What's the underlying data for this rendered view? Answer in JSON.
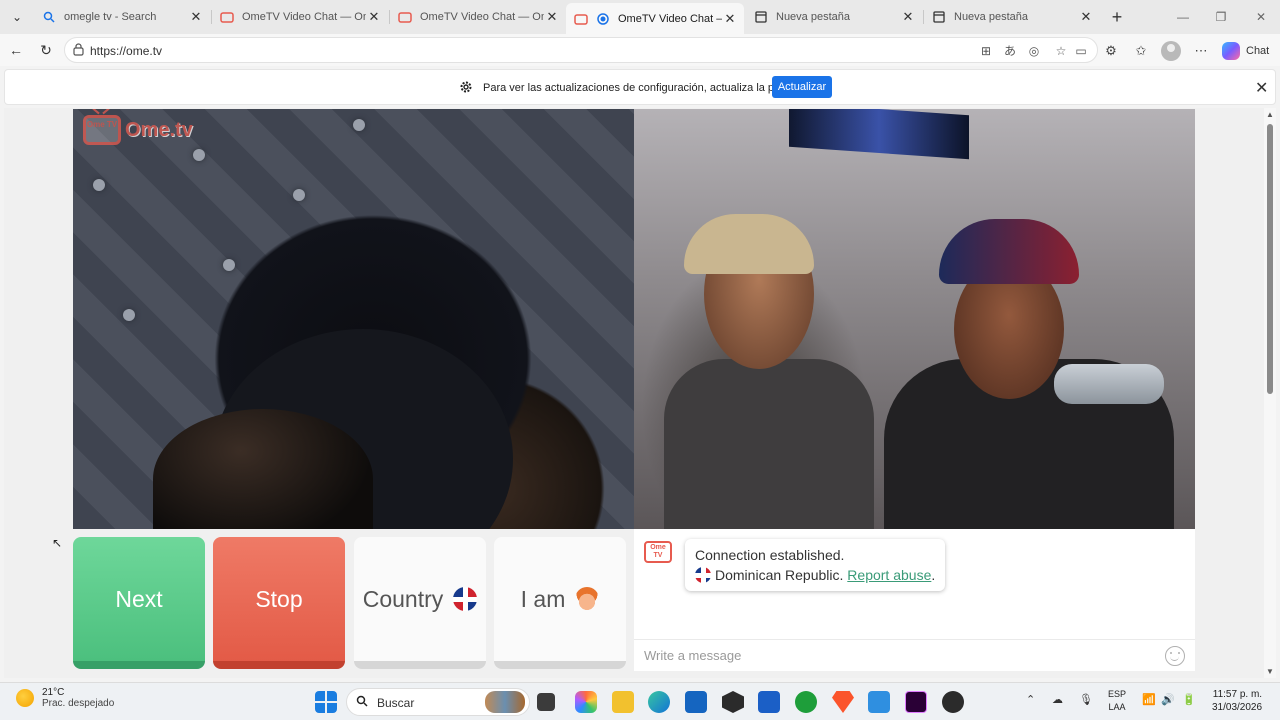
{
  "browser": {
    "tabs": [
      {
        "title": "omegle tv - Search",
        "favicon": "search-icon"
      },
      {
        "title": "OmeTV Video Chat — Omegle",
        "favicon": "ometv-icon"
      },
      {
        "title": "OmeTV Video Chat — Omegle",
        "favicon": "ometv-icon"
      },
      {
        "title": "OmeTV Video Chat — Omegle",
        "favicon": "ometv-icon",
        "active": true
      },
      {
        "title": "Nueva pestaña",
        "favicon": "newtab-icon"
      },
      {
        "title": "Nueva pestaña",
        "favicon": "newtab-icon"
      }
    ],
    "url": "https://ome.tv",
    "chat_label": "Chat"
  },
  "infobar": {
    "message": "Para ver las actualizaciones de configuración, actualiza la página",
    "button": "Actualizar"
  },
  "page": {
    "logo_text": "Ome.tv",
    "logo_badge": "Ome TV",
    "buttons": {
      "next": "Next",
      "stop": "Stop",
      "country": "Country",
      "iam": "I am"
    },
    "chat": {
      "line1": "Connection established.",
      "country": "Dominican Republic.",
      "report": "Report abuse",
      "placeholder": "Write a message"
    }
  },
  "taskbar": {
    "temp": "21°C",
    "weather": "Prac. despejado",
    "search": "Buscar",
    "lang1": "ESP",
    "lang2": "LAA",
    "time": "11:57 p. m.",
    "date": "31/03/2026"
  },
  "colors": {
    "next": "#4cc07e",
    "stop": "#e35b47",
    "accent": "#1a73e8",
    "brand": "#e75b4f"
  }
}
